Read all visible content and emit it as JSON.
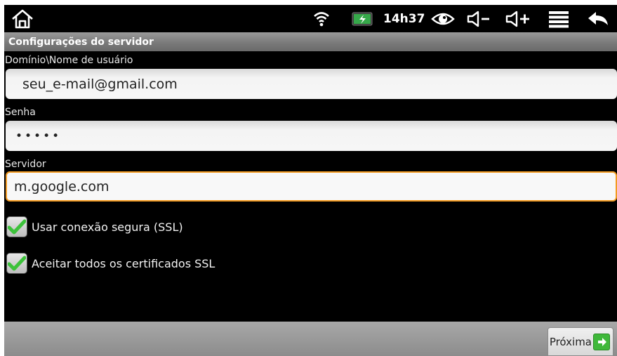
{
  "status_bar": {
    "time": "14h37",
    "icons": [
      "home-icon",
      "wifi-icon",
      "battery-icon",
      "eye-icon",
      "volume-down-icon",
      "volume-up-icon",
      "menu-icon",
      "back-icon"
    ]
  },
  "title_bar": {
    "title": "Configurações do servidor"
  },
  "form": {
    "username_label": "Domínio\\Nome de usuário",
    "username_value": "seu_e-mail@gmail.com",
    "password_label": "Senha",
    "password_value": "•••••",
    "server_label": "Servidor",
    "server_value": "m.google.com"
  },
  "options": {
    "ssl_label": "Usar conexão segura (SSL)",
    "ssl_checked": true,
    "cert_label": "Aceitar todos os certificados SSL",
    "cert_checked": true
  },
  "bottom_bar": {
    "next_label": "Próxima"
  },
  "colors": {
    "focus_border": "#f29a21",
    "check_green": "#3cc23a",
    "next_icon_green": "#3fb83a"
  }
}
